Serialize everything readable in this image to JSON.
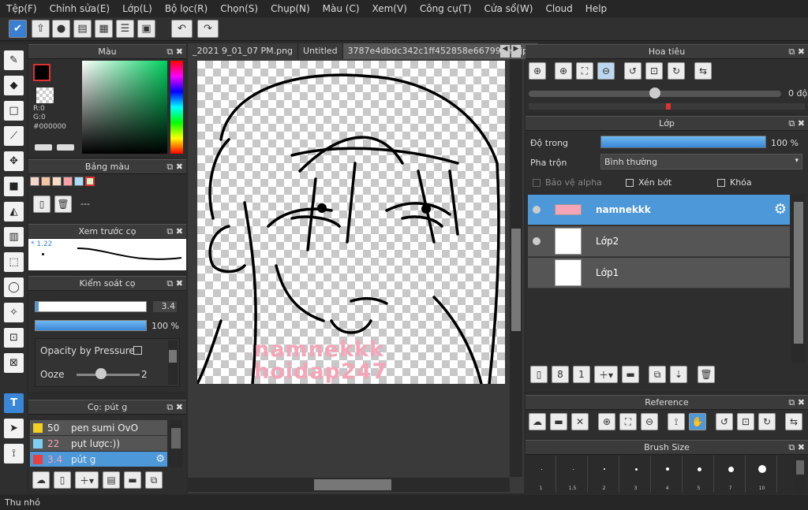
{
  "menu": [
    "Tệp(F)",
    "Chỉnh sửa(E)",
    "Lớp(L)",
    "Bộ lọc(R)",
    "Chọn(S)",
    "Chụp(N)",
    "Màu (C)",
    "Xem(V)",
    "Công cụ(T)",
    "Cửa sổ(W)",
    "Cloud",
    "Help"
  ],
  "color_panel": {
    "title": "Màu",
    "r": "R:0",
    "g": "G:0",
    "hex": "#000000"
  },
  "palette": {
    "title": "Bảng màu",
    "label": "---"
  },
  "brush_preview": {
    "title": "Xem trước cọ",
    "size": "* 1.22"
  },
  "brush_control": {
    "title": "Kiểm soát cọ",
    "size": "3.4",
    "opacity": "100 %",
    "pressure_label": "Opacity by Pressure",
    "ooze_label": "Ooze",
    "ooze_value": "2",
    "opacity_fraction": 1.0
  },
  "brush_list": {
    "title": "Cọ: pút g",
    "items": [
      {
        "size": "50",
        "name": "pen sumi OvO",
        "color": "#f0d020"
      },
      {
        "size": "22",
        "name": "pụt lược:))",
        "color": "#7fd0f0"
      },
      {
        "size": "3.4",
        "name": "pút g",
        "color": "#e84040"
      }
    ]
  },
  "tabs": [
    "_2021 9_01_07 PM.png",
    "Untitled",
    "3787e4dbdc342c1ff452858e66799de5.jpg"
  ],
  "watermark": [
    "namnekkk",
    "hoidap247"
  ],
  "navigator": {
    "title": "Hoa tiêu",
    "angle": "0 độ"
  },
  "layers": {
    "title": "Lớp",
    "opacity_label": "Độ trong",
    "opacity_value": "100 %",
    "opacity_fraction": 1.0,
    "blend_label": "Pha trộn",
    "blend_value": "Bình thường",
    "protect_alpha": "Bảo vệ alpha",
    "clip": "Xén bớt",
    "lock": "Khóa",
    "items": [
      {
        "name": "namnekkk"
      },
      {
        "name": "Lớp2"
      },
      {
        "name": "Lớp1"
      }
    ]
  },
  "reference": {
    "title": "Reference"
  },
  "brush_size": {
    "title": "Brush Size",
    "sizes": [
      "1",
      "1.5",
      "2",
      "3",
      "4",
      "5",
      "7",
      "10"
    ]
  },
  "status": "Thu nhỏ",
  "colors": {
    "accent": "#4d98d8",
    "watermark": "#f4a5b8"
  }
}
